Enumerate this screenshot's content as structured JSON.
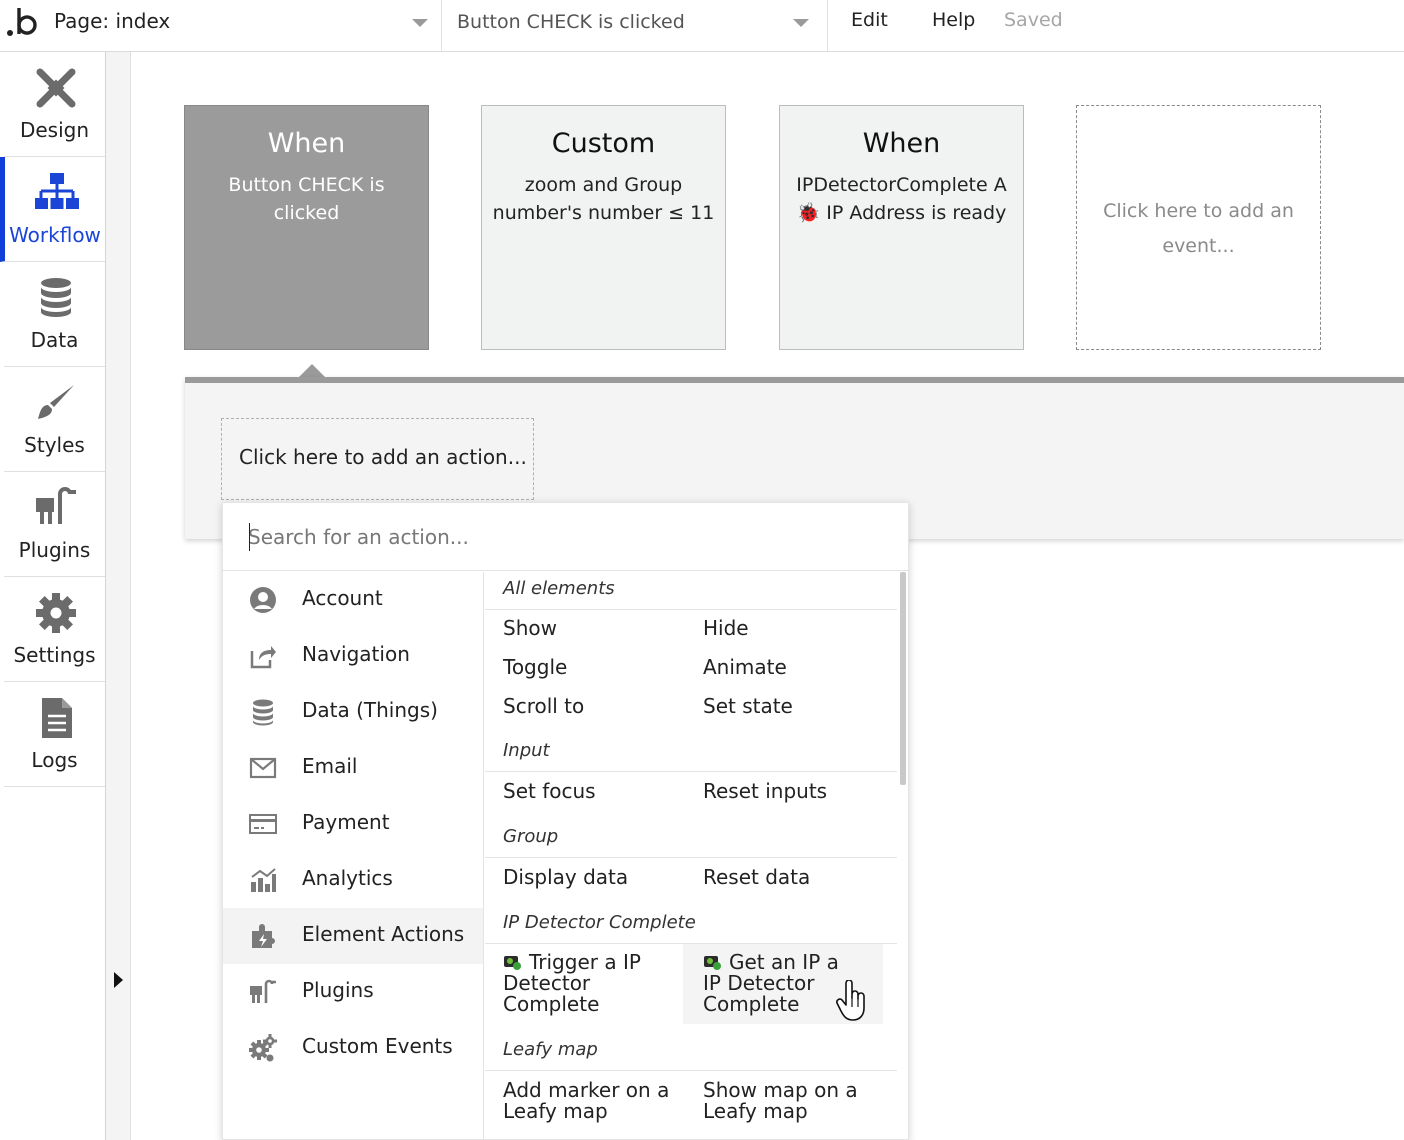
{
  "topbar": {
    "page_label": "Page: index",
    "workflow_label": "Button CHECK is clicked",
    "edit": "Edit",
    "help": "Help",
    "saved": "Saved"
  },
  "sidebar": {
    "items": [
      {
        "label": "Design",
        "icon": "design-icon"
      },
      {
        "label": "Workflow",
        "icon": "workflow-icon",
        "active": true
      },
      {
        "label": "Data",
        "icon": "database-icon"
      },
      {
        "label": "Styles",
        "icon": "brush-icon"
      },
      {
        "label": "Plugins",
        "icon": "plug-icon"
      },
      {
        "label": "Settings",
        "icon": "gear-icon"
      },
      {
        "label": "Logs",
        "icon": "document-icon"
      }
    ]
  },
  "events": [
    {
      "title": "When",
      "desc": "Button CHECK is clicked",
      "selected": true
    },
    {
      "title": "Custom",
      "desc": "zoom and Group number's number ≤ 11"
    },
    {
      "title": "When",
      "desc": "IPDetectorComplete A 🐞 IP Address is ready"
    },
    {
      "title": "",
      "desc": "Click here to add an event..."
    }
  ],
  "action_area": {
    "add_action": "Click here to add an action..."
  },
  "dropdown": {
    "search_placeholder": "Search for an action...",
    "categories": [
      {
        "label": "Account",
        "icon": "account-icon"
      },
      {
        "label": "Navigation",
        "icon": "navigation-icon"
      },
      {
        "label": "Data (Things)",
        "icon": "database-icon"
      },
      {
        "label": "Email",
        "icon": "email-icon"
      },
      {
        "label": "Payment",
        "icon": "payment-icon"
      },
      {
        "label": "Analytics",
        "icon": "analytics-icon"
      },
      {
        "label": "Element Actions",
        "icon": "element-actions-icon",
        "active": true
      },
      {
        "label": "Plugins",
        "icon": "plug-icon"
      },
      {
        "label": "Custom Events",
        "icon": "gears-icon"
      }
    ],
    "sections": {
      "all_elements": {
        "title": "All elements",
        "items": [
          "Show",
          "Hide",
          "Toggle",
          "Animate",
          "Scroll to",
          "Set state"
        ]
      },
      "input": {
        "title": "Input",
        "items": [
          "Set focus",
          "Reset inputs"
        ]
      },
      "group": {
        "title": "Group",
        "items": [
          "Display data",
          "Reset data"
        ]
      },
      "ip_detector": {
        "title": "IP Detector Complete",
        "items": [
          "Trigger a IP Detector Complete",
          "Get an IP a IP Detector Complete"
        ]
      },
      "leafy_map": {
        "title": "Leafy map",
        "items": [
          "Add marker on a Leafy map",
          "Show map on a Leafy map"
        ]
      }
    }
  }
}
